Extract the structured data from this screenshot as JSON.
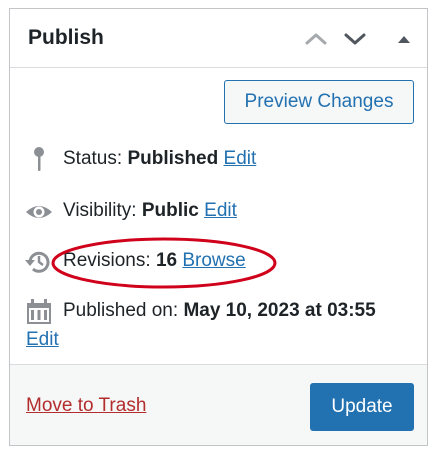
{
  "header": {
    "title": "Publish",
    "move_up_icon": "chevron-up-icon",
    "move_down_icon": "chevron-down-icon",
    "toggle_icon": "triangle-up-icon"
  },
  "preview_button": "Preview Changes",
  "status": {
    "icon": "pin-icon",
    "label": "Status:",
    "value": "Published",
    "edit": "Edit"
  },
  "visibility": {
    "icon": "eye-icon",
    "label": "Visibility:",
    "value": "Public",
    "edit": "Edit"
  },
  "revisions": {
    "icon": "history-icon",
    "label": "Revisions:",
    "value": "16",
    "browse": "Browse",
    "highlight_color": "#d0021b"
  },
  "published": {
    "icon": "calendar-icon",
    "label": "Published on:",
    "value": "May 10, 2023 at 03:55",
    "edit": "Edit"
  },
  "footer": {
    "trash": "Move to Trash",
    "update": "Update"
  },
  "colors": {
    "accent": "#2271b1",
    "danger": "#b32d2e",
    "icon": "#8c8f94"
  }
}
